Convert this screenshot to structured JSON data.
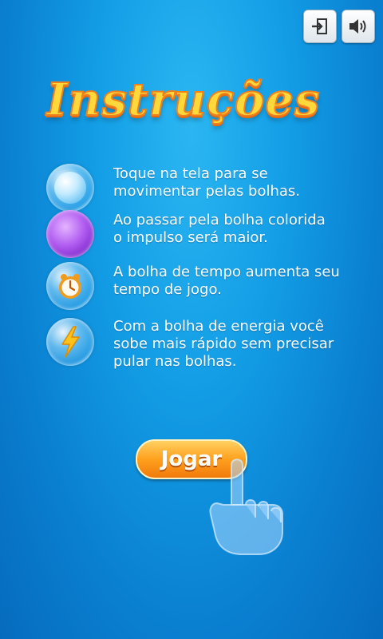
{
  "title": "Instruções",
  "header": {
    "exit_icon": "exit-icon",
    "sound_icon": "speaker-icon"
  },
  "instructions": [
    {
      "icon": "blue-bubble-icon",
      "text_line1": "Toque na tela para se",
      "text_line2": "movimentar pelas bolhas."
    },
    {
      "icon": "purple-bubble-icon",
      "text_line1": "Ao passar pela bolha colorida",
      "text_line2": "o impulso será maior."
    },
    {
      "icon": "clock-bubble-icon",
      "text_line1": "A bolha de tempo aumenta seu",
      "text_line2": "tempo de jogo."
    },
    {
      "icon": "lightning-bubble-icon",
      "text_line1": "Com a bolha de energia você",
      "text_line2": "sobe mais rápido sem precisar",
      "text_line3": "pular nas bolhas."
    }
  ],
  "play_button": {
    "label": "Jogar"
  },
  "colors": {
    "background": "#139ee6",
    "title_fill": "#ffd93b",
    "title_outline": "#f0801e",
    "button": "#ffa11e"
  }
}
